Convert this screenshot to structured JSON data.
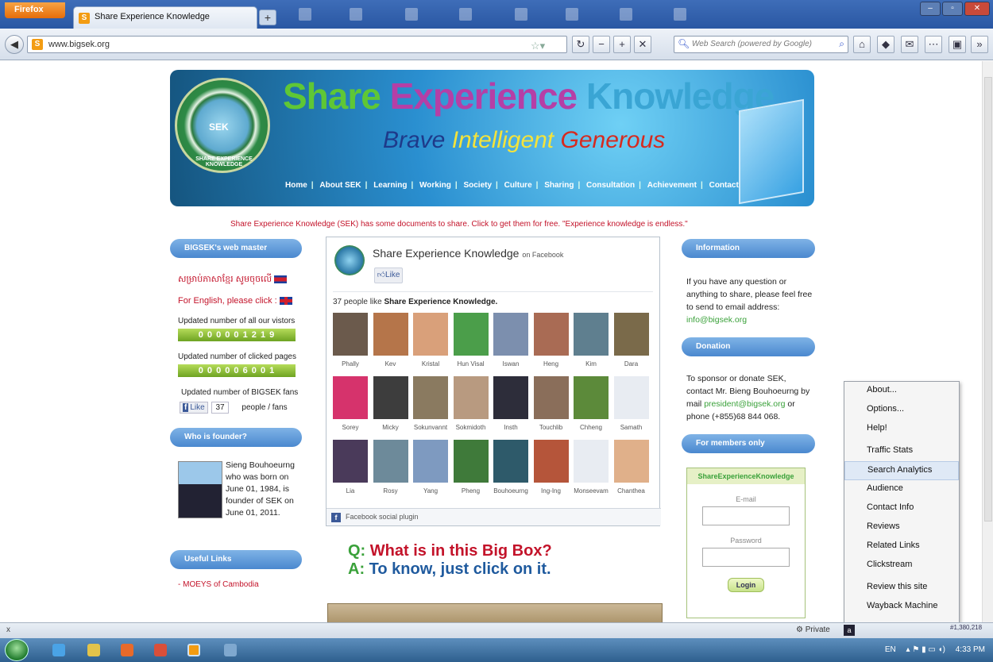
{
  "browser": {
    "app_button": "Firefox",
    "tab_title": "Share Experience Knowledge",
    "url": "www.bigsek.org",
    "search_placeholder": "Web Search (powered by Google)"
  },
  "site": {
    "headline": [
      "Share",
      "Experience",
      "Knowledge"
    ],
    "slogan": [
      "Brave",
      "Intelligent",
      "Generous"
    ],
    "seal_label": "SEK",
    "seal_ring": "SHARE EXPERIENCE KNOWLEDGE",
    "menu": [
      "Home",
      "About SEK",
      "Learning",
      "Working",
      "Society",
      "Culture",
      "Sharing",
      "Consultation",
      "Achievement",
      "Contact"
    ],
    "notice": "Share Experience Knowledge (SEK) has some documents to share. Click       to get them for free. \"Experience knowledge is endless.\""
  },
  "left": {
    "webmaster_title": "BIGSEK's web master",
    "khmer_link": "សម្រាប់ភាសាខ្មែរ សូមចុចលើ",
    "english_link": "For English, please click :",
    "visitors_label": "Updated number of all our vistors",
    "visitors_digits": "0 0 0 0 0 1 2 1 9",
    "pages_label": "Updated number of clicked pages",
    "pages_digits": "0 0 0 0 0 6 0 0 1",
    "fans_label": "Updated number of BIGSEK fans",
    "fans_like": "Like",
    "fans_count": "37",
    "fans_suffix": "people / fans",
    "founder_title": "Who is founder?",
    "founder_text": "Sieng Bouhoeurng who was born on June 01, 1984, is founder of SEK on June 01, 2011.",
    "links_title": "Useful Links",
    "link1": "- MOEYS of Cambodia"
  },
  "facebook": {
    "page_name": "Share Experience Knowledge",
    "on": "on Facebook",
    "like": "Like",
    "count_text": "37 people like",
    "count_bold": "Share Experience Knowledge.",
    "faces": [
      {
        "name": "Phally",
        "color": "#6b5a4c"
      },
      {
        "name": "Kev",
        "color": "#b5754a"
      },
      {
        "name": "Kristal",
        "color": "#d9a07a"
      },
      {
        "name": "Hun Visal",
        "color": "#4b9e4a"
      },
      {
        "name": "Iswan",
        "color": "#7c8fae"
      },
      {
        "name": "Heng",
        "color": "#a96b54"
      },
      {
        "name": "Kim",
        "color": "#5f7f8f"
      },
      {
        "name": "Dara",
        "color": "#7a6a4a"
      },
      {
        "name": "Sorey",
        "color": "#d6336c"
      },
      {
        "name": "Micky",
        "color": "#3d3d3d"
      },
      {
        "name": "Sokunvannt",
        "color": "#8a7a60"
      },
      {
        "name": "Sokmidoth",
        "color": "#b89a80"
      },
      {
        "name": "Insth",
        "color": "#2d2d3a"
      },
      {
        "name": "Touchlib",
        "color": "#8a6e5a"
      },
      {
        "name": "Chheng",
        "color": "#5c8a3a"
      },
      {
        "name": "Samath",
        "color": "#e8ecf2"
      },
      {
        "name": "Lia",
        "color": "#4a3a5a"
      },
      {
        "name": "Rosy",
        "color": "#6d8a9a"
      },
      {
        "name": "Yang",
        "color": "#7e9ac0"
      },
      {
        "name": "Pheng",
        "color": "#3f7a3a"
      },
      {
        "name": "Bouhoeurng",
        "color": "#2e5a6a"
      },
      {
        "name": "Ing-Ing",
        "color": "#b5553a"
      },
      {
        "name": "Monseevam",
        "color": "#e8ecf2"
      },
      {
        "name": "Chanthea",
        "color": "#e0b08a"
      }
    ],
    "footer": "Facebook social plugin"
  },
  "qa": {
    "q_label": "Q:",
    "q_text": "What is in this Big Box?",
    "a_label": "A:",
    "a_text": "To know, just click on it."
  },
  "right": {
    "info_title": "Information",
    "info_text": "If you have any question or anything to share, please feel free to send to email address:",
    "info_email": "info@bigsek.org",
    "donation_title": "Donation",
    "donation_text": "To sponsor or donate SEK, contact Mr. Bieng Bouhoeurng by mail",
    "donation_email": "president@bigsek.org",
    "donation_phone": "or phone (+855)68 844 068.",
    "members_title": "For members only",
    "login_title": "ShareExperienceKnowledge",
    "email_label": "E-mail",
    "password_label": "Password",
    "login_button": "Login"
  },
  "context_menu": {
    "items": [
      "About...",
      "Options...",
      "Help!",
      "Traffic Stats",
      "Search Analytics",
      "Audience",
      "Contact Info",
      "Reviews",
      "Related Links",
      "Clickstream",
      "Review this site",
      "Wayback Machine"
    ],
    "highlighted": "Search Analytics"
  },
  "status": {
    "close": "x",
    "private": "Private",
    "rank": "#1,380,218"
  },
  "taskbar": {
    "lang": "EN",
    "time": "4:33 PM"
  }
}
